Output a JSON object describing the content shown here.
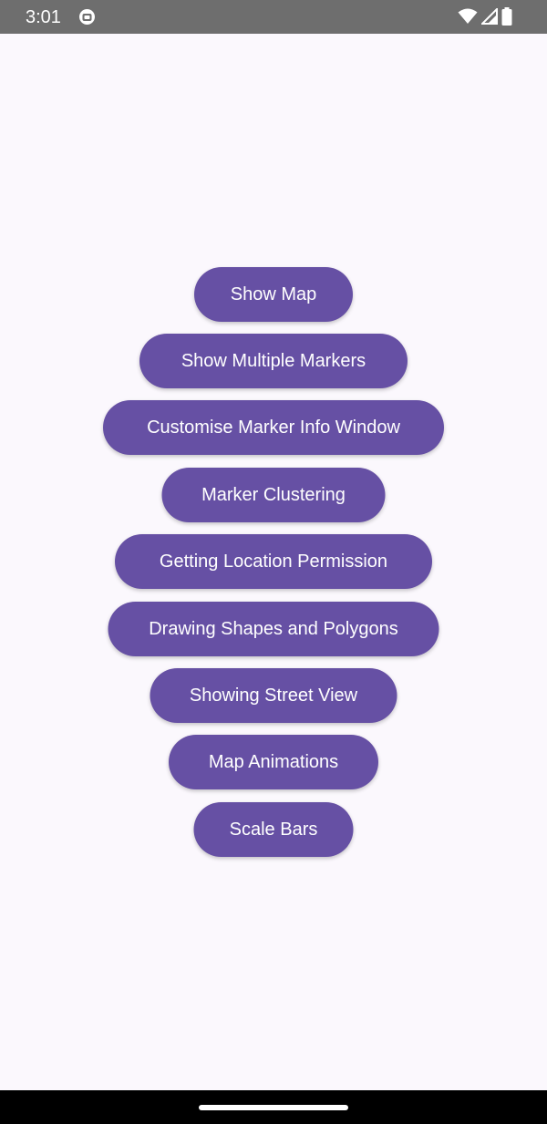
{
  "status_bar": {
    "time": "3:01",
    "icons": [
      "app-notification-icon",
      "wifi-icon",
      "cellular-signal-icon",
      "battery-icon"
    ]
  },
  "menu": {
    "buttons": [
      {
        "label": "Show Map"
      },
      {
        "label": "Show Multiple Markers"
      },
      {
        "label": "Customise Marker Info Window"
      },
      {
        "label": "Marker Clustering"
      },
      {
        "label": "Getting Location Permission"
      },
      {
        "label": "Drawing Shapes and Polygons"
      },
      {
        "label": "Showing Street View"
      },
      {
        "label": "Map Animations"
      },
      {
        "label": "Scale Bars"
      }
    ]
  },
  "colors": {
    "button_bg": "#6650a4",
    "button_text": "#ffffff",
    "background": "#fbf8fd",
    "status_bar": "#6e6e6e",
    "nav_bar": "#000000"
  }
}
